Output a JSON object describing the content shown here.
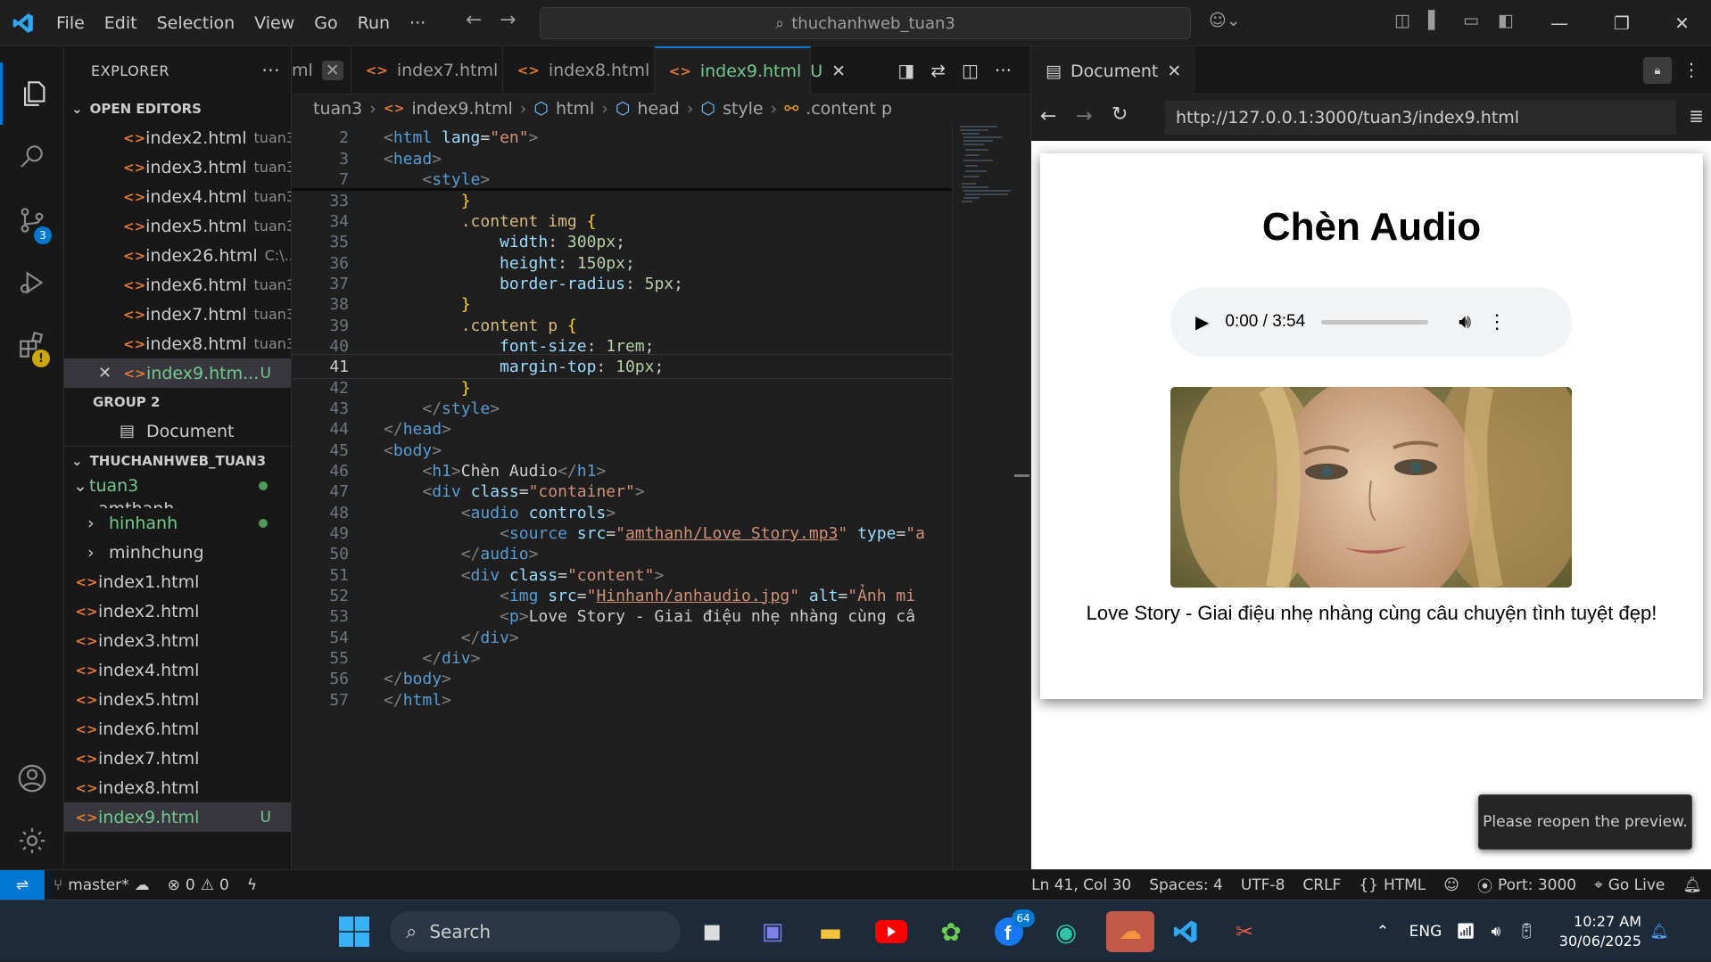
{
  "titlebar": {
    "menu": [
      "File",
      "Edit",
      "Selection",
      "View",
      "Go",
      "Run",
      "···"
    ],
    "command_center": "thuchanhweb_tuan3"
  },
  "activity": {
    "scm_badge": "3"
  },
  "explorer": {
    "title": "EXPLORER",
    "open_editors_label": "OPEN EDITORS",
    "open_editors": [
      {
        "name": "index2.html",
        "desc": "tuan3"
      },
      {
        "name": "index3.html",
        "desc": "tuan3"
      },
      {
        "name": "index4.html",
        "desc": "tuan3"
      },
      {
        "name": "index5.html",
        "desc": "tuan3"
      },
      {
        "name": "index26.html",
        "desc": "C:\\..."
      },
      {
        "name": "index6.html",
        "desc": "tuan3"
      },
      {
        "name": "index7.html",
        "desc": "tuan3"
      },
      {
        "name": "index8.html",
        "desc": "tuan3"
      },
      {
        "name": "index9.htm...",
        "desc": "U"
      }
    ],
    "group2_label": "GROUP 2",
    "group2_item": "Document",
    "workspace_label": "THUCHANHWEB_TUAN3",
    "folder": "tuan3",
    "partial_folder": "amthanh",
    "tree": [
      {
        "name": "hinhanh",
        "type": "folder",
        "git": "modified"
      },
      {
        "name": "minhchung",
        "type": "folder"
      },
      {
        "name": "index1.html",
        "type": "file"
      },
      {
        "name": "index2.html",
        "type": "file"
      },
      {
        "name": "index3.html",
        "type": "file"
      },
      {
        "name": "index4.html",
        "type": "file"
      },
      {
        "name": "index5.html",
        "type": "file"
      },
      {
        "name": "index6.html",
        "type": "file"
      },
      {
        "name": "index7.html",
        "type": "file"
      },
      {
        "name": "index8.html",
        "type": "file"
      },
      {
        "name": "index9.html",
        "type": "file",
        "git": "U"
      }
    ]
  },
  "editor": {
    "tabs": [
      "ml",
      "index7.html",
      "index8.html",
      "index9.html"
    ],
    "active_tab_status": "U",
    "breadcrumb": [
      "tuan3",
      "index9.html",
      "html",
      "head",
      "style",
      ".content p"
    ],
    "line_numbers": [
      "2",
      "3",
      "7",
      "33",
      "34",
      "35",
      "36",
      "37",
      "38",
      "39",
      "40",
      "41",
      "42",
      "43",
      "44",
      "45",
      "46",
      "47",
      "48",
      "49",
      "50",
      "51",
      "52",
      "53",
      "54",
      "55",
      "56",
      "57"
    ],
    "current_line": "41"
  },
  "preview": {
    "tab_title": "Document",
    "url": "http://127.0.0.1:3000/tuan3/index9.html",
    "heading": "Chèn Audio",
    "audio_time": "0:00 / 3:54",
    "caption": "Love Story - Giai điệu nhẹ nhàng cùng câu chuyện tình tuyệt đẹp!",
    "toast": "Please reopen the preview."
  },
  "status": {
    "branch": "master*",
    "errors": "0",
    "warnings": "0",
    "position": "Ln 41, Col 30",
    "spaces": "Spaces: 4",
    "encoding": "UTF-8",
    "eol": "CRLF",
    "language": "HTML",
    "port": "Port: 3000",
    "golive": "Go Live"
  },
  "taskbar": {
    "search": "Search",
    "teams_badge": "64",
    "lang": "ENG",
    "time": "10:27 AM",
    "date": "30/06/2025"
  },
  "colors": {
    "accent": "#0078d4",
    "git_green": "#73c991",
    "html_icon": "#e37933"
  }
}
